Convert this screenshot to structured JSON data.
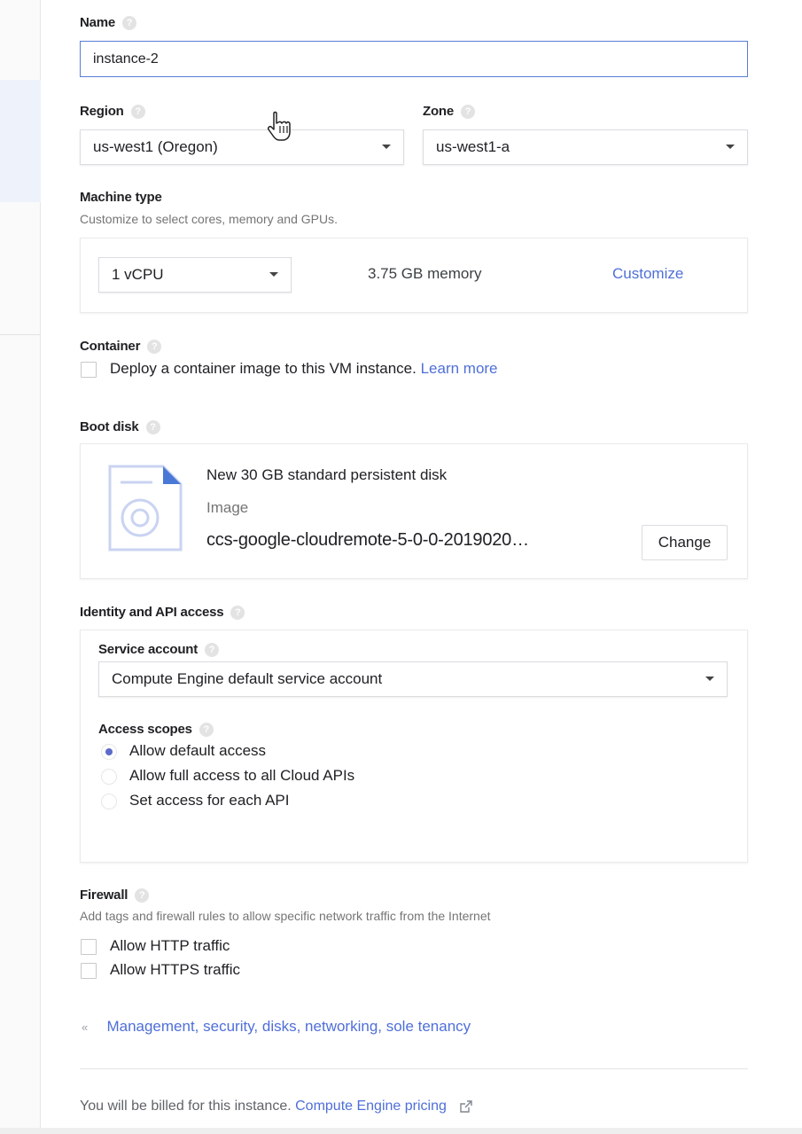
{
  "name": {
    "label": "Name",
    "value": "instance-2"
  },
  "region": {
    "label": "Region",
    "value": "us-west1 (Oregon)"
  },
  "zone": {
    "label": "Zone",
    "value": "us-west1-a"
  },
  "machine_type": {
    "label": "Machine type",
    "sublabel": "Customize to select cores, memory and GPUs.",
    "cpu_value": "1 vCPU",
    "memory": "3.75 GB memory",
    "customize_link": "Customize"
  },
  "container": {
    "label": "Container",
    "checkbox_label": "Deploy a container image to this VM instance.",
    "learn_more": "Learn more",
    "checked": false
  },
  "boot_disk": {
    "label": "Boot disk",
    "title": "New 30 GB standard persistent disk",
    "image_label": "Image",
    "image_name": "ccs-google-cloudremote-5-0-0-2019020…",
    "change_button": "Change"
  },
  "identity": {
    "label": "Identity and API access",
    "service_account_label": "Service account",
    "service_account_value": "Compute Engine default service account",
    "access_scopes_label": "Access scopes",
    "scopes": [
      {
        "label": "Allow default access",
        "selected": true
      },
      {
        "label": "Allow full access to all Cloud APIs",
        "selected": false
      },
      {
        "label": "Set access for each API",
        "selected": false
      }
    ]
  },
  "firewall": {
    "label": "Firewall",
    "sublabel": "Add tags and firewall rules to allow specific network traffic from the Internet",
    "options": [
      {
        "label": "Allow HTTP traffic",
        "checked": false
      },
      {
        "label": "Allow HTTPS traffic",
        "checked": false
      }
    ]
  },
  "management_link": "Management, security, disks, networking, sole tenancy",
  "billing": {
    "text": "You will be billed for this instance.",
    "link": "Compute Engine pricing"
  },
  "colors": {
    "accent": "#4f6fd8",
    "radio_selected": "#5b6bc9",
    "input_focus_border": "#5a7cd6"
  },
  "icons": [
    "help-icon",
    "dropdown-caret-icon",
    "disk-image-icon",
    "expand-chevrons-icon",
    "external-link-icon",
    "hand-pointer-cursor"
  ]
}
